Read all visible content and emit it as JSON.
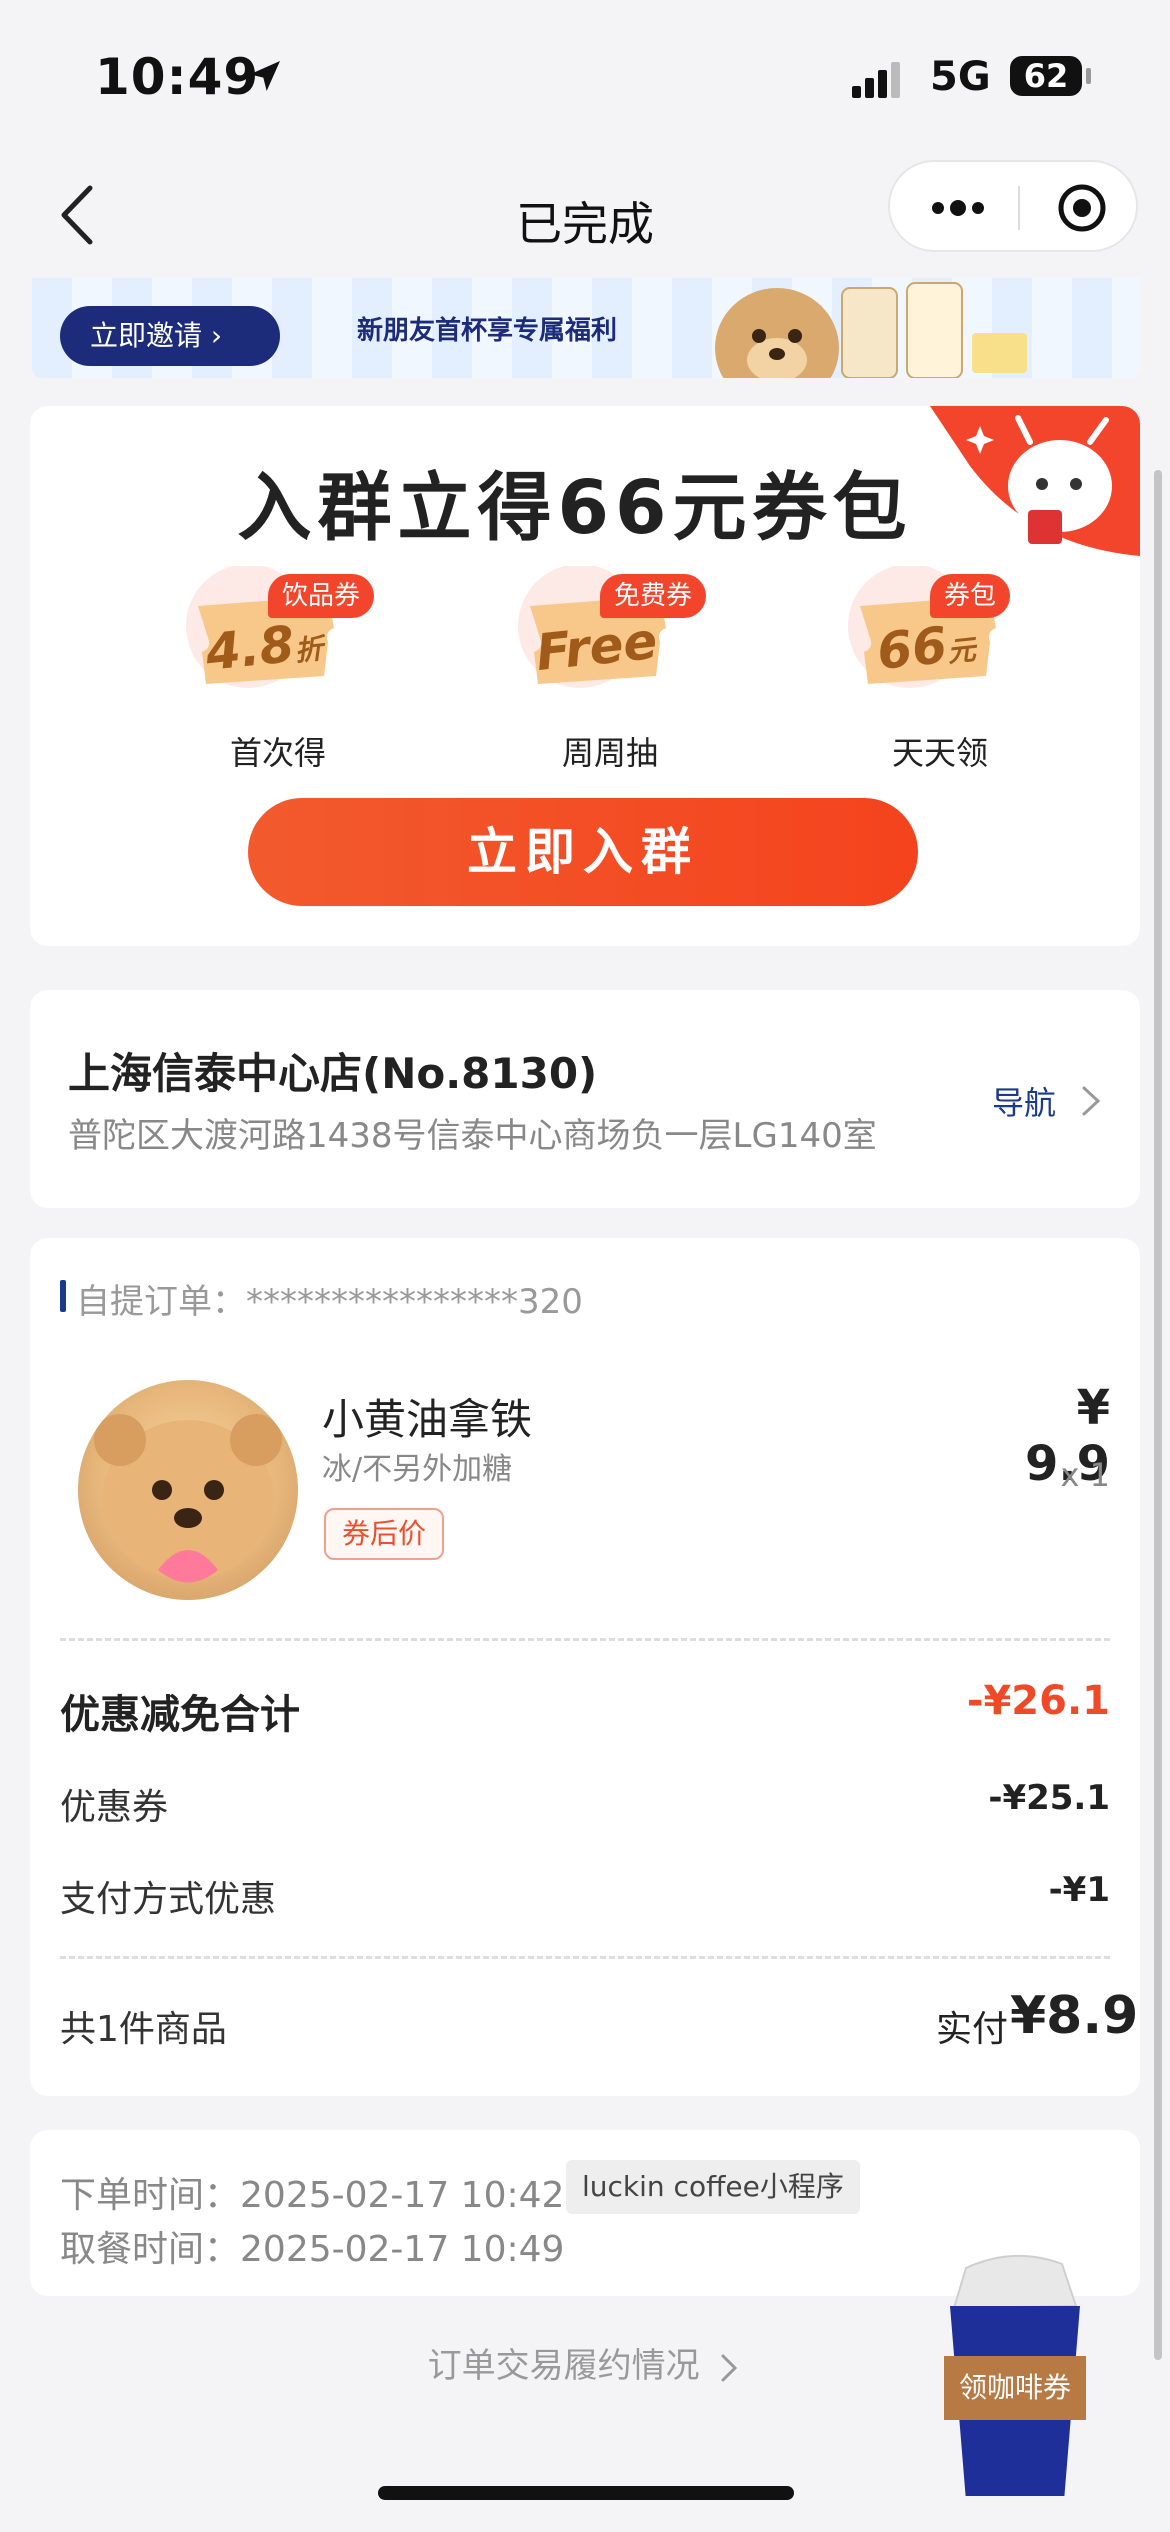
{
  "status_bar": {
    "time": "10:49",
    "network": "5G",
    "battery": "62"
  },
  "nav": {
    "title": "已完成"
  },
  "invite_banner": {
    "button_label": "立即邀请",
    "caption": "新朋友首杯享专属福利"
  },
  "group_card": {
    "title": "入群立得66元券包",
    "perks": [
      {
        "tag": "饮品券",
        "ticket_value": "4.8",
        "ticket_unit": "折",
        "caption": "首次得"
      },
      {
        "tag": "免费券",
        "ticket_value": "Free",
        "ticket_unit": "",
        "caption": "周周抽"
      },
      {
        "tag": "券包",
        "ticket_value": "66",
        "ticket_unit": "元",
        "caption": "天天领"
      }
    ],
    "join_button": "立即入群"
  },
  "store": {
    "name": "上海信泰中心店(No.8130)",
    "address": "普陀区大渡河路1438号信泰中心商场负一层LG140室",
    "nav_label": "导航"
  },
  "order": {
    "label": "自提订单：",
    "number": "****************320",
    "item": {
      "name": "小黄油拿铁",
      "spec": "冰/不另外加糖",
      "badge": "券后价",
      "price": "¥ 9.9",
      "qty": "x 1"
    },
    "discount_total_label": "优惠减免合计",
    "discount_total": "-¥26.1",
    "rows": [
      {
        "label": "优惠券",
        "value": "-¥25.1"
      },
      {
        "label": "支付方式优惠",
        "value": "-¥1"
      }
    ],
    "count_label": "共1件商品",
    "paid_label": "实付",
    "paid_value": "¥8.9"
  },
  "times": {
    "order_time_label": "下单时间：",
    "order_time": "2025-02-17 10:42",
    "source": "luckin coffee小程序",
    "pickup_time_label": "取餐时间：",
    "pickup_time": "2025-02-17 10:49"
  },
  "footer": {
    "link": "订单交易履约情况"
  },
  "coffee_widget": {
    "label": "领咖啡券"
  },
  "colors": {
    "brand_blue": "#1d3a8a",
    "accent_red": "#f2452c",
    "discount_red": "#ef4a28"
  },
  "icons": [
    "location-arrow-icon",
    "signal-icon",
    "back-chevron-icon",
    "more-icon",
    "target-icon",
    "chevron-right-icon",
    "ticket-icon",
    "coffee-cup-icon"
  ]
}
